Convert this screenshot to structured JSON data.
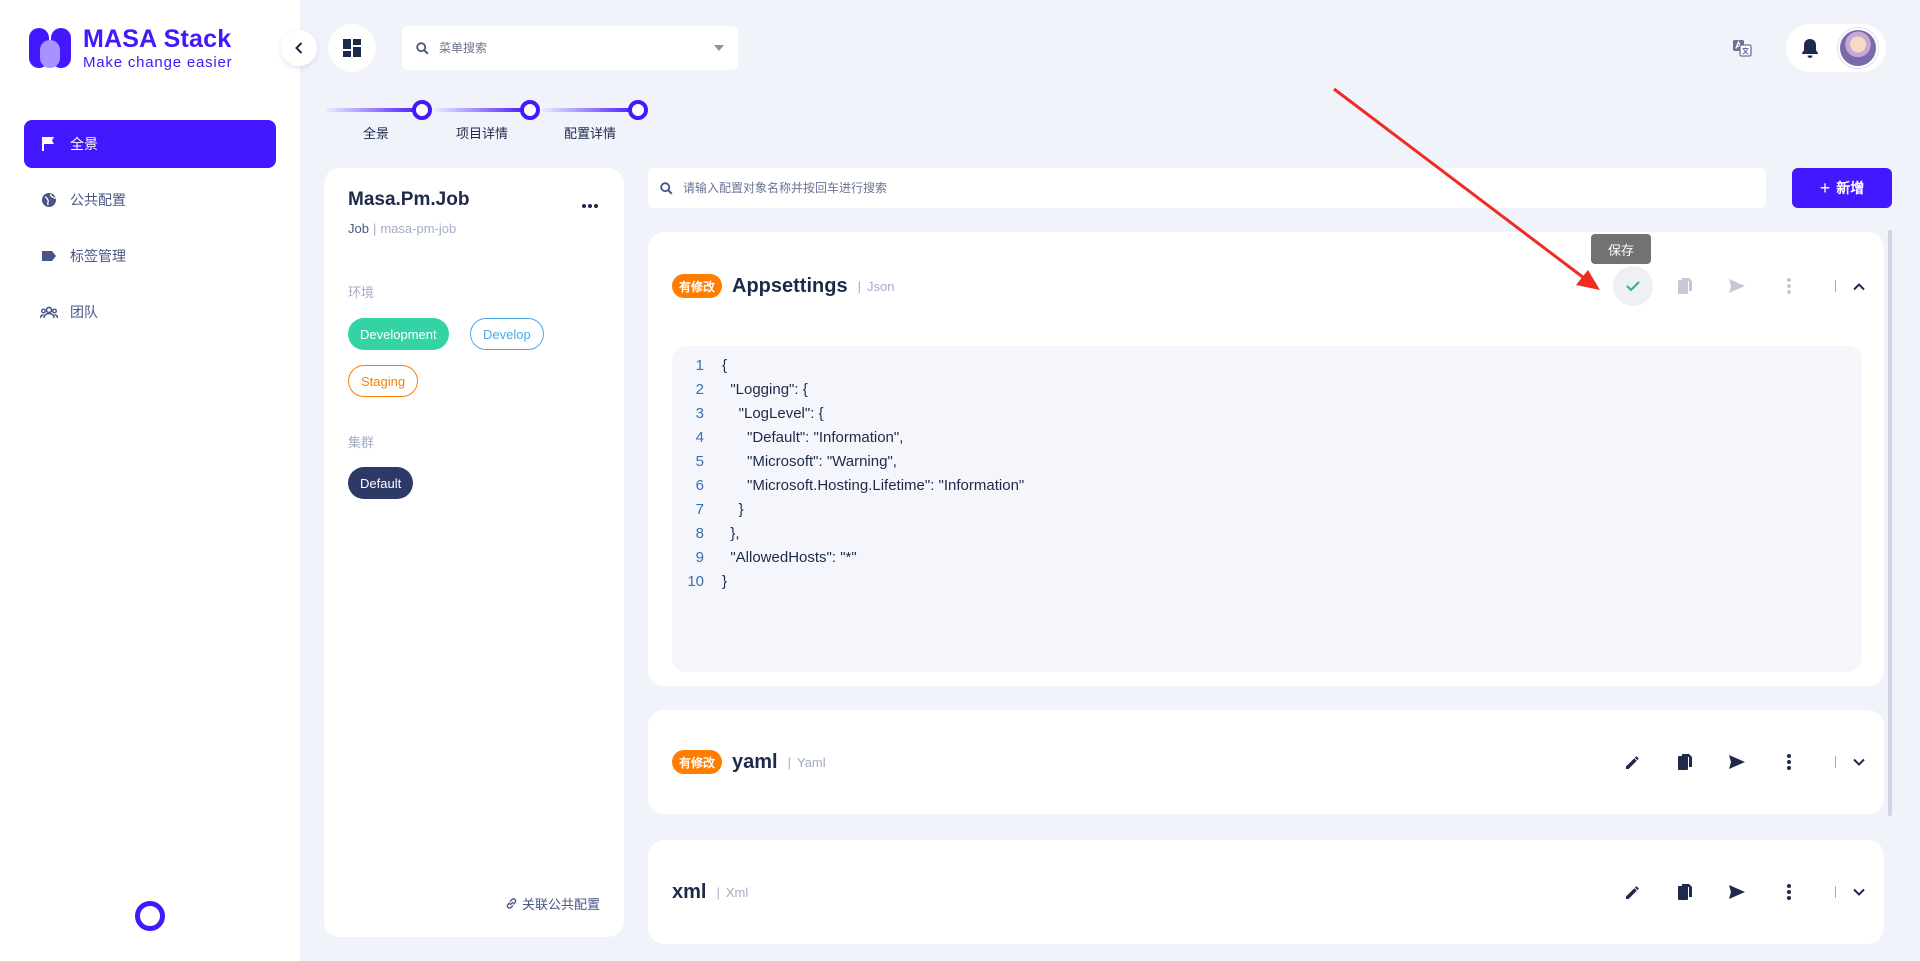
{
  "app": {
    "logo_name": "MASA Stack",
    "logo_tagline": "Make change easier"
  },
  "sidebar": {
    "items": [
      {
        "label": "全景",
        "icon": "flag-icon",
        "active": true
      },
      {
        "label": "公共配置",
        "icon": "globe-icon",
        "active": false
      },
      {
        "label": "标签管理",
        "icon": "tag-icon",
        "active": false
      },
      {
        "label": "团队",
        "icon": "team-icon",
        "active": false
      }
    ]
  },
  "header": {
    "menu_search_placeholder": "菜单搜索"
  },
  "stepper": {
    "steps": [
      "全景",
      "项目详情",
      "配置详情"
    ]
  },
  "project": {
    "name": "Masa.Pm.Job",
    "type": "Job",
    "identity": "masa-pm-job",
    "env_label": "环境",
    "envs": [
      "Development",
      "Develop",
      "Staging"
    ],
    "cluster_label": "集群",
    "clusters": [
      "Default"
    ],
    "link_public_config": "关联公共配置"
  },
  "config": {
    "search_placeholder": "请输入配置对象名称并按回车进行搜索",
    "add_label": "新增",
    "save_tooltip": "保存",
    "objects": [
      {
        "badge": "有修改",
        "name": "Appsettings",
        "format": "Json",
        "expanded": true,
        "editing": true,
        "code": [
          "{",
          "  \"Logging\": {",
          "    \"LogLevel\": {",
          "      \"Default\": \"Information\",",
          "      \"Microsoft\": \"Warning\",",
          "      \"Microsoft.Hosting.Lifetime\": \"Information\"",
          "    }",
          "  },",
          "  \"AllowedHosts\": \"*\"",
          "}"
        ]
      },
      {
        "badge": "有修改",
        "name": "yaml",
        "format": "Yaml",
        "expanded": false
      },
      {
        "badge": "",
        "name": "xml",
        "format": "Xml",
        "expanded": false
      }
    ]
  },
  "colors": {
    "accent": "#4318ff",
    "modified_badge": "#ff7d00",
    "dev_chip": "#34d3a5",
    "develop_chip": "#4da9e6",
    "staging_chip": "#ff7d00",
    "cluster_chip": "#2e3a66",
    "annotation_arrow": "#ef2b24"
  }
}
